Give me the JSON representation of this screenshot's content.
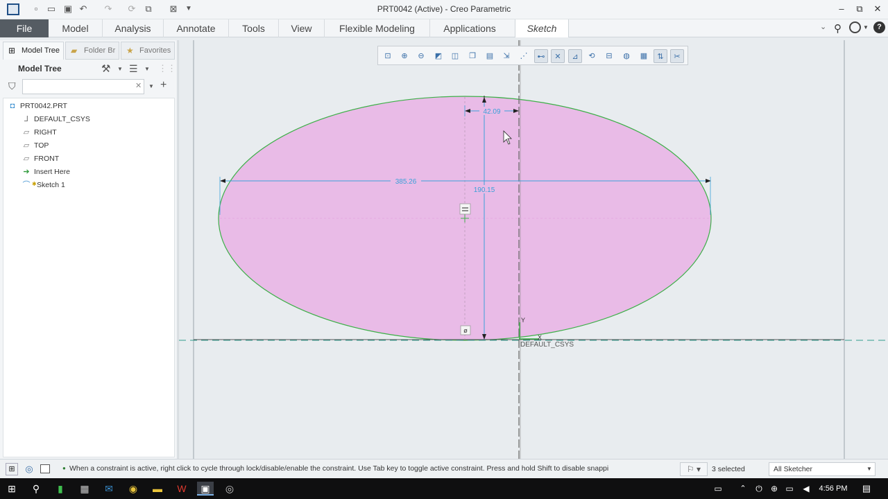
{
  "window": {
    "title": "PRT0042 (Active) - Creo Parametric",
    "minimize": "–",
    "restore": "⧉",
    "close": "✕"
  },
  "quick_access": [
    "new-icon",
    "open-icon",
    "save-icon",
    "undo-icon",
    "redo-icon",
    "regenerate-icon",
    "windows-icon",
    "close-window-icon",
    "customize-icon"
  ],
  "ribbon": {
    "tabs": [
      "File",
      "Model",
      "Analysis",
      "Annotate",
      "Tools",
      "View",
      "Flexible Modeling",
      "Applications",
      "Sketch"
    ],
    "active_tab": "Sketch"
  },
  "left_panel": {
    "tabs": [
      "Model Tree",
      "Folder Br",
      "Favorites"
    ],
    "heading": "Model Tree",
    "filter_placeholder": "",
    "tree": [
      {
        "label": "PRT0042.PRT",
        "icon": "part-icon"
      },
      {
        "label": "DEFAULT_CSYS",
        "icon": "csys-icon"
      },
      {
        "label": "RIGHT",
        "icon": "datum-plane-icon"
      },
      {
        "label": "TOP",
        "icon": "datum-plane-icon"
      },
      {
        "label": "FRONT",
        "icon": "datum-plane-icon"
      },
      {
        "label": "Insert Here",
        "icon": "insert-arrow-icon"
      },
      {
        "label": "Sketch 1",
        "icon": "sketch-icon"
      }
    ]
  },
  "sketch": {
    "dim_width": "385.26",
    "dim_height": "190.15",
    "dim_offset": "42.09",
    "csys_label": "DEFAULT_CSYS",
    "axis_y": "Y",
    "axis_x": "X",
    "fill_color": "#e9bbe7",
    "edge_color": "#3daf48",
    "dim_color": "#3aa0d8"
  },
  "status": {
    "message": "When a constraint is active, right click to cycle through lock/disable/enable the constraint. Use Tab key to toggle active constraint. Press and hold Shift to disable snappi",
    "selected": "3 selected",
    "filter": "All Sketcher"
  },
  "taskbar": {
    "time": "4:56 PM"
  }
}
